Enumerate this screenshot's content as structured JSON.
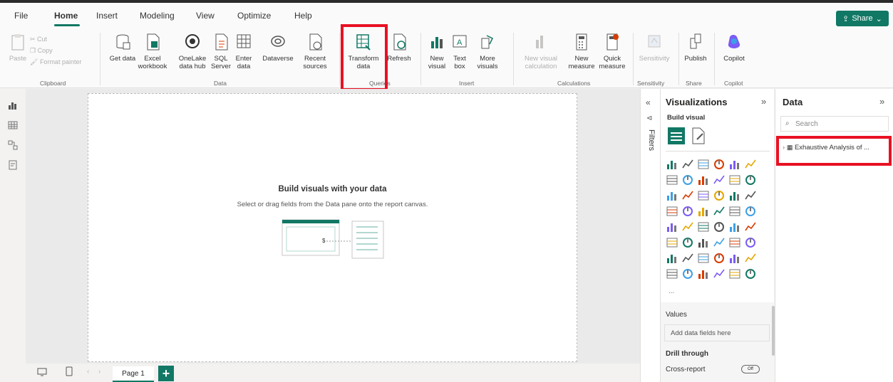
{
  "menu": {
    "items": [
      "File",
      "Home",
      "Insert",
      "Modeling",
      "View",
      "Optimize",
      "Help"
    ],
    "active": "Home",
    "share_label": "Share"
  },
  "ribbon": {
    "clipboard": {
      "paste": "Paste",
      "cut": "Cut",
      "copy": "Copy",
      "format_painter": "Format painter",
      "group": "Clipboard"
    },
    "data": {
      "get_data": "Get data",
      "excel": "Excel workbook",
      "onelake": "OneLake data hub",
      "sql": "SQL Server",
      "enter": "Enter data",
      "dataverse": "Dataverse",
      "recent": "Recent sources",
      "group": "Data"
    },
    "queries": {
      "transform": "Transform data",
      "refresh": "Refresh",
      "group": "Queries"
    },
    "insert": {
      "new_visual": "New visual",
      "text_box": "Text box",
      "more_visuals": "More visuals",
      "group": "Insert"
    },
    "calculations": {
      "new_visual_calc": "New visual calculation",
      "new_measure": "New measure",
      "quick_measure": "Quick measure",
      "group": "Calculations"
    },
    "sensitivity": {
      "label": "Sensitivity",
      "group": "Sensitivity"
    },
    "share": {
      "publish": "Publish",
      "group": "Share"
    },
    "copilot": {
      "label": "Copilot",
      "group": "Copilot"
    }
  },
  "canvas": {
    "empty_title": "Build visuals with your data",
    "empty_subtitle": "Select or drag fields from the Data pane onto the report canvas."
  },
  "pages": {
    "tab": "Page 1",
    "add": "+"
  },
  "filters": {
    "label": "Filters"
  },
  "visualizations": {
    "title": "Visualizations",
    "build_visual": "Build visual",
    "more": "...",
    "values_label": "Values",
    "values_placeholder": "Add data fields here",
    "drill_through": "Drill through",
    "cross_report": "Cross-report",
    "toggle": "Off"
  },
  "data_pane": {
    "title": "Data",
    "search_placeholder": "Search",
    "table_name": "Exhaustive Analysis of ..."
  },
  "colors": {
    "accent": "#117865",
    "highlight": "#e81123"
  }
}
